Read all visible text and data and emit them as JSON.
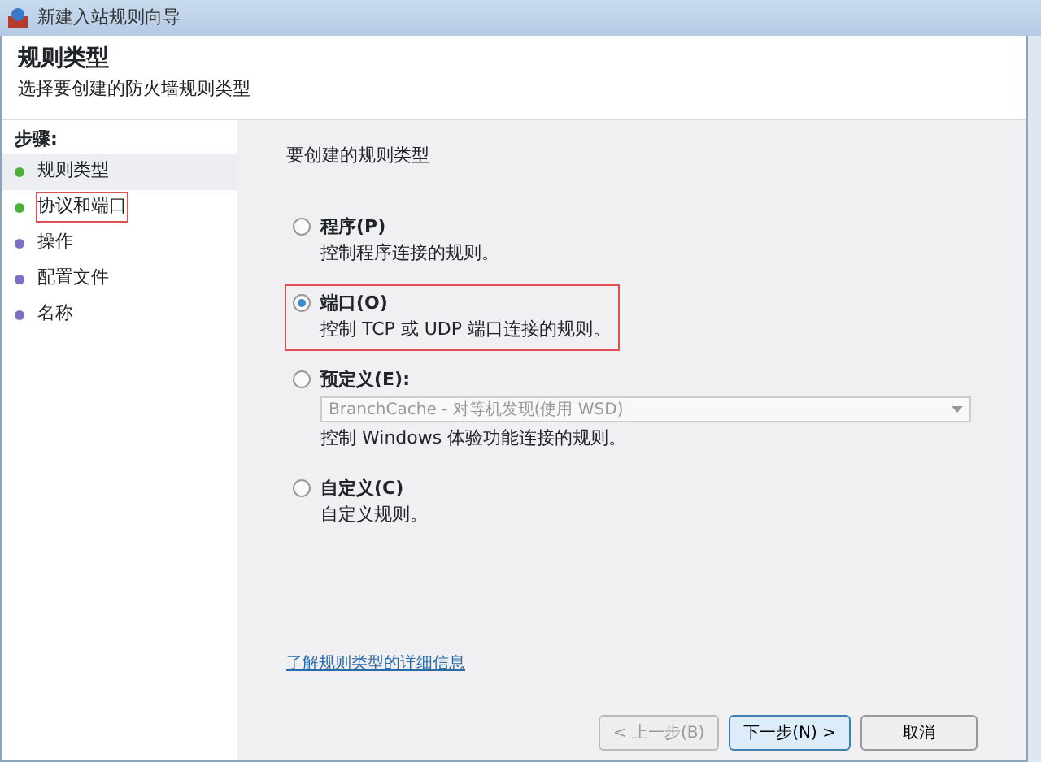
{
  "window": {
    "title": "新建入站规则向导"
  },
  "header": {
    "title": "规则类型",
    "subtitle": "选择要创建的防火墙规则类型"
  },
  "steps": {
    "heading": "步骤:",
    "items": [
      {
        "label": "规则类型",
        "selected": true,
        "annotated": false,
        "color": "#4caf3c"
      },
      {
        "label": "协议和端口",
        "selected": false,
        "annotated": true,
        "color": "#4caf3c"
      },
      {
        "label": "操作",
        "selected": false,
        "annotated": false,
        "color": "#7a6fc0"
      },
      {
        "label": "配置文件",
        "selected": false,
        "annotated": false,
        "color": "#7a6fc0"
      },
      {
        "label": "名称",
        "selected": false,
        "annotated": false,
        "color": "#7a6fc0"
      }
    ]
  },
  "main": {
    "prompt": "要创建的规则类型",
    "options": [
      {
        "label": "程序(P)",
        "description": "控制程序连接的规则。",
        "selected": false,
        "annotated": false
      },
      {
        "label": "端口(O)",
        "description": "控制 TCP 或 UDP 端口连接的规则。",
        "selected": true,
        "annotated": true
      },
      {
        "label": "预定义(E):",
        "dropdown": {
          "value": "BranchCache - 对等机发现(使用 WSD)",
          "disabled": true
        },
        "description": "控制 Windows 体验功能连接的规则。",
        "selected": false,
        "annotated": false
      },
      {
        "label": "自定义(C)",
        "description": "自定义规则。",
        "selected": false,
        "annotated": false
      }
    ],
    "link": "了解规则类型的详细信息"
  },
  "buttons": [
    {
      "label": "< 上一步(B)",
      "disabled": true,
      "default": false
    },
    {
      "label": "下一步(N) >",
      "disabled": false,
      "default": true
    },
    {
      "label": "取消",
      "disabled": false,
      "default": false
    }
  ]
}
